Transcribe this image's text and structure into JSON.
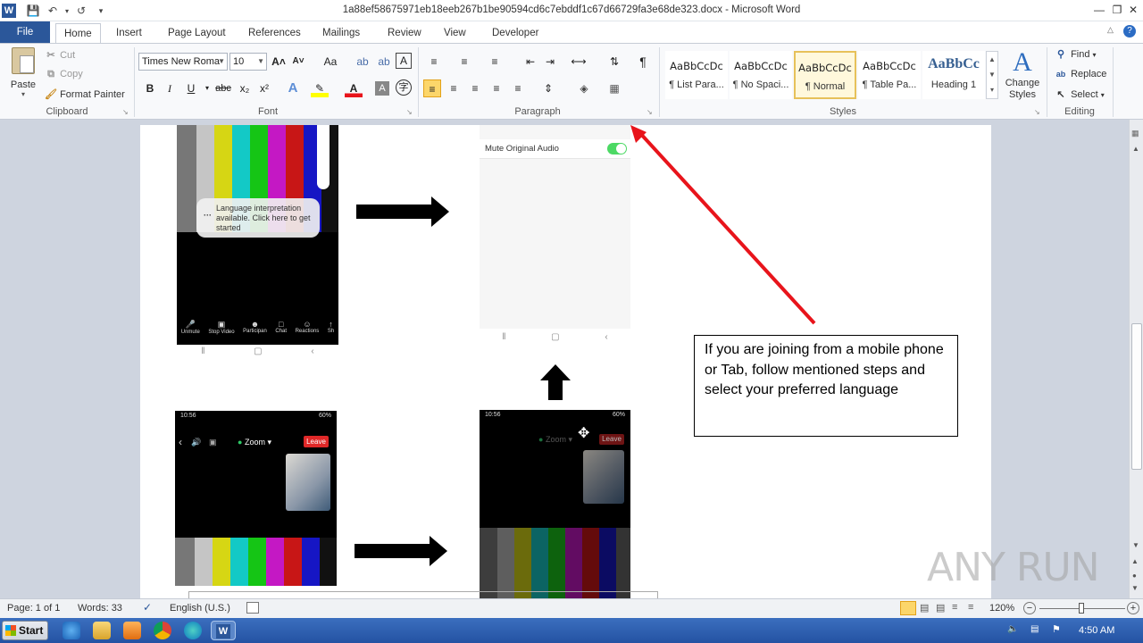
{
  "window": {
    "title": "1a88ef58675971eb18eeb267b1be90594cd6c7ebddf1c67d66729fa3e68de323.docx - Microsoft Word"
  },
  "tabs": [
    "File",
    "Home",
    "Insert",
    "Page Layout",
    "References",
    "Mailings",
    "Review",
    "View",
    "Developer"
  ],
  "clipboard": {
    "paste": "Paste",
    "cut": "Cut",
    "copy": "Copy",
    "format_painter": "Format Painter",
    "label": "Clipboard"
  },
  "font": {
    "name": "Times New Roma",
    "size": "10",
    "label": "Font",
    "bold": "B",
    "italic": "I",
    "underline": "U",
    "strike": "abc",
    "sub": "x₂",
    "sup": "x²",
    "grow": "A˄",
    "shrink": "A˅",
    "case": "Aa",
    "clear": "A"
  },
  "paragraph": {
    "label": "Paragraph",
    "pilcrow": "¶"
  },
  "styles": {
    "label": "Styles",
    "items": [
      {
        "sample": "AaBbCcDc",
        "name": "¶ List Para..."
      },
      {
        "sample": "AaBbCcDc",
        "name": "¶ No Spaci..."
      },
      {
        "sample": "AaBbCcDc",
        "name": "¶ Normal"
      },
      {
        "sample": "AaBbCcDc",
        "name": "¶ Table Pa..."
      },
      {
        "sample": "AaBbCc",
        "name": "Heading 1"
      }
    ],
    "change_styles": "Change Styles",
    "change_styles_icon": "A"
  },
  "editing": {
    "label": "Editing",
    "find": "Find",
    "replace": "Replace",
    "select": "Select"
  },
  "document": {
    "popup_text": "Language interpretation available. Click here to get started",
    "mute_label": "Mute Original Audio",
    "toolbar_items": [
      "Unmute",
      "Stop Video",
      "Participan",
      "Chat",
      "Reactions",
      "Sh"
    ],
    "phone_status_left": "10:56",
    "phone_status_right": "60%",
    "zoom_label": "Zoom",
    "leave_label": "Leave",
    "textbox": "If you are joining from a mobile phone or Tab, follow mentioned steps and select your preferred language"
  },
  "status": {
    "page": "Page: 1 of 1",
    "words": "Words: 33",
    "language": "English (U.S.)",
    "zoom": "120%"
  },
  "taskbar": {
    "start": "Start",
    "clock": "4:50 AM"
  },
  "watermark": "ANY RUN",
  "colors": {
    "accent": "#2b579a",
    "red_arrow": "#e8141b",
    "toggle_on": "#4cd964",
    "leave": "#e02828"
  }
}
